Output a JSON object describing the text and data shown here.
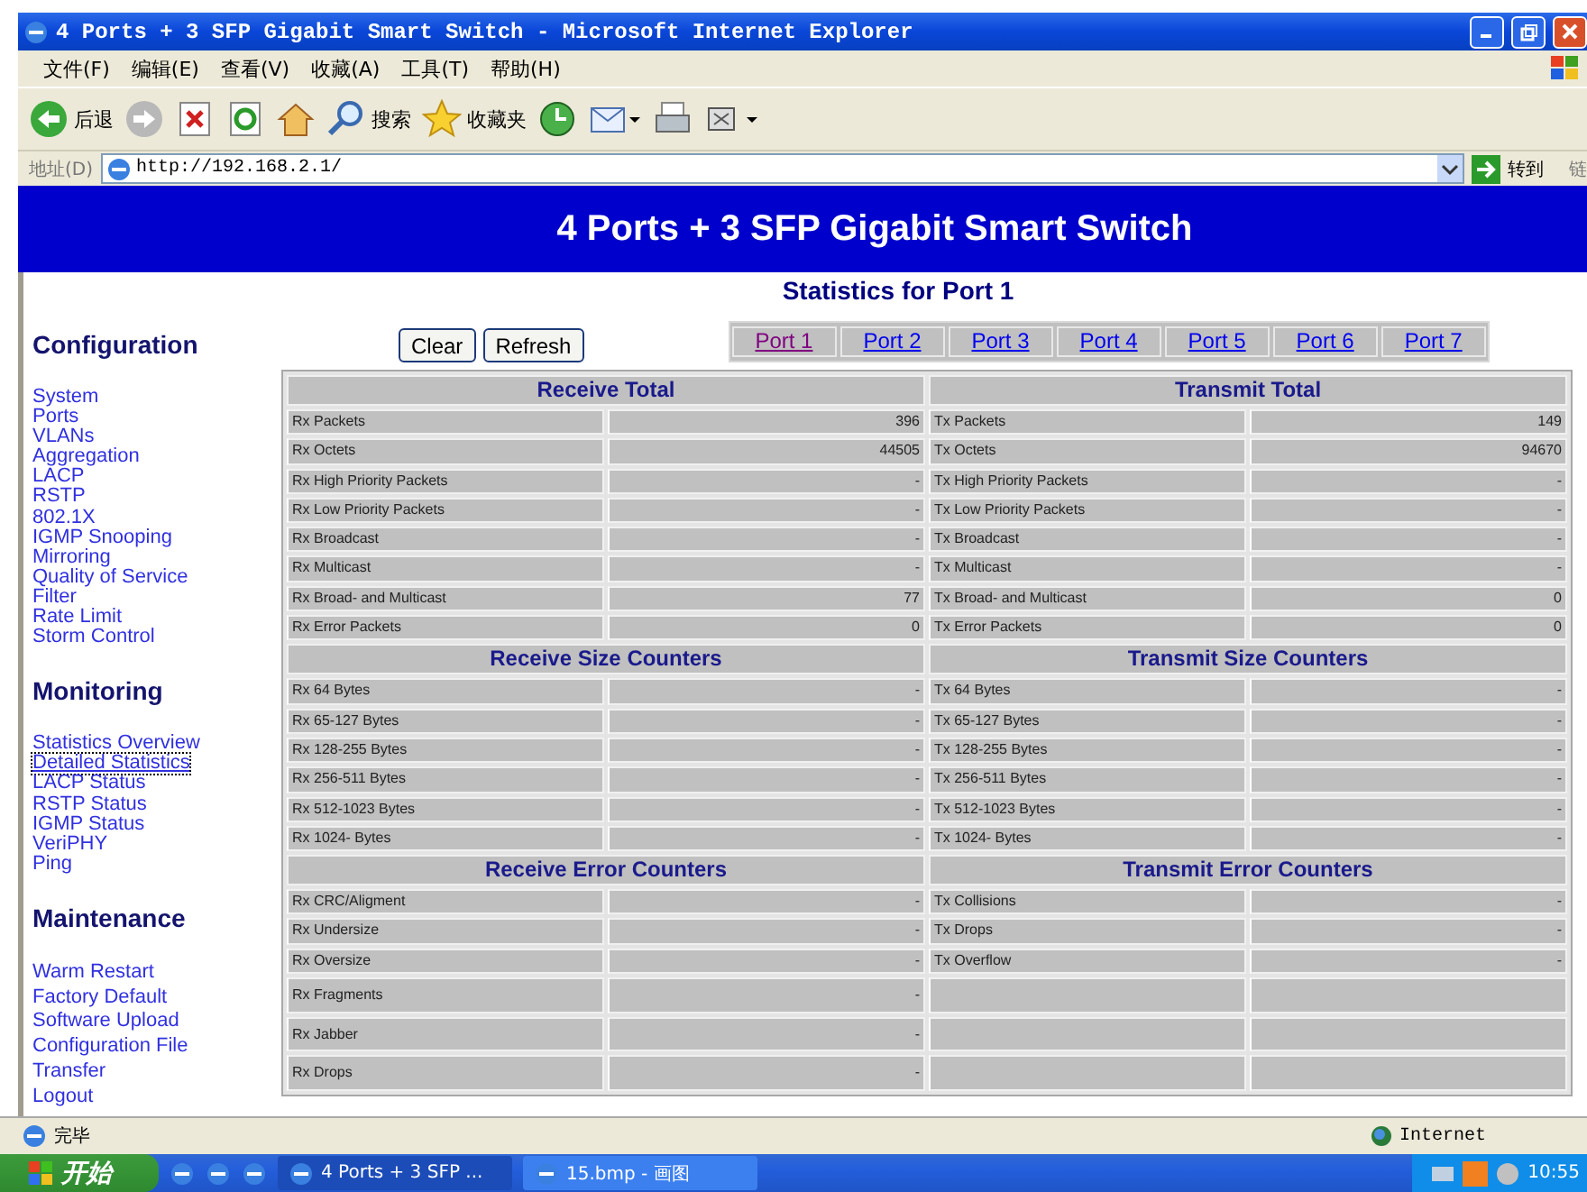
{
  "window": {
    "title": "4 Ports + 3 SFP Gigabit Smart Switch - Microsoft Internet Explorer"
  },
  "menu": [
    "文件(F)",
    "编辑(E)",
    "查看(V)",
    "收藏(A)",
    "工具(T)",
    "帮助(H)"
  ],
  "toolbar": [
    {
      "kind": "back",
      "label": "后退"
    },
    {
      "kind": "forward"
    },
    {
      "kind": "stop"
    },
    {
      "kind": "refresh"
    },
    {
      "kind": "home"
    },
    {
      "kind": "search",
      "label": "搜索"
    },
    {
      "kind": "favorites",
      "label": "收藏夹"
    },
    {
      "kind": "history"
    },
    {
      "kind": "mail"
    },
    {
      "kind": "print"
    },
    {
      "kind": "edit"
    }
  ],
  "address": {
    "label": "地址(D)",
    "value": "http://192.168.2.1/",
    "go": "转到",
    "links": "链"
  },
  "banner": "4 Ports + 3 SFP Gigabit Smart Switch",
  "page_title": "Statistics for Port 1",
  "sidebar": [
    {
      "title": "Configuration",
      "items": [
        {
          "label": "System",
          "selected": false
        },
        {
          "label": "Ports",
          "selected": false
        },
        {
          "label": "VLANs",
          "selected": false
        },
        {
          "label": "Aggregation",
          "selected": false
        },
        {
          "label": "LACP",
          "selected": false
        },
        {
          "label": "RSTP",
          "selected": false
        },
        {
          "label": "802.1X",
          "selected": false
        },
        {
          "label": "IGMP Snooping",
          "selected": false
        },
        {
          "label": "Mirroring",
          "selected": false
        },
        {
          "label": "Quality of Service",
          "selected": false
        },
        {
          "label": "Filter",
          "selected": false
        },
        {
          "label": "Rate Limit",
          "selected": false
        },
        {
          "label": "Storm Control",
          "selected": false
        }
      ]
    },
    {
      "title": "Monitoring",
      "items": [
        {
          "label": "Statistics Overview",
          "selected": false
        },
        {
          "label": "Detailed Statistics",
          "selected": true
        },
        {
          "label": "LACP Status",
          "selected": false
        },
        {
          "label": "RSTP Status",
          "selected": false
        },
        {
          "label": "IGMP Status",
          "selected": false
        },
        {
          "label": "VeriPHY",
          "selected": false
        },
        {
          "label": "Ping",
          "selected": false
        }
      ]
    },
    {
      "title": "Maintenance",
      "items": [
        {
          "label": "Warm Restart",
          "selected": false
        },
        {
          "label": "Factory Default",
          "selected": false
        },
        {
          "label": "Software Upload",
          "selected": false
        },
        {
          "label": "Configuration File",
          "selected": false
        },
        {
          "label": "Transfer",
          "selected": false
        },
        {
          "label": "Logout",
          "selected": false
        }
      ]
    }
  ],
  "buttons": [
    "Clear",
    "Refresh"
  ],
  "port_tabs": [
    {
      "label": "Port 1",
      "selected": true
    },
    {
      "label": "Port 2",
      "selected": false
    },
    {
      "label": "Port 3",
      "selected": false
    },
    {
      "label": "Port 4",
      "selected": false
    },
    {
      "label": "Port 5",
      "selected": false
    },
    {
      "label": "Port 6",
      "selected": false
    },
    {
      "label": "Port 7",
      "selected": false
    }
  ],
  "stats": [
    {
      "rx_title": "Receive Total",
      "tx_title": "Transmit Total",
      "rows": [
        {
          "rx_label": "Rx Packets",
          "rx_value": "396",
          "tx_label": "Tx Packets",
          "tx_value": "149"
        },
        {
          "rx_label": "Rx Octets",
          "rx_value": "44505",
          "tx_label": "Tx Octets",
          "tx_value": "94670"
        },
        {
          "rx_label": "Rx High Priority Packets",
          "rx_value": "-",
          "tx_label": "Tx High Priority Packets",
          "tx_value": "-"
        },
        {
          "rx_label": "Rx Low Priority Packets",
          "rx_value": "-",
          "tx_label": "Tx Low Priority Packets",
          "tx_value": "-"
        },
        {
          "rx_label": "Rx Broadcast",
          "rx_value": "-",
          "tx_label": "Tx Broadcast",
          "tx_value": "-"
        },
        {
          "rx_label": "Rx Multicast",
          "rx_value": "-",
          "tx_label": "Tx Multicast",
          "tx_value": "-"
        },
        {
          "rx_label": "Rx Broad- and Multicast",
          "rx_value": "77",
          "tx_label": "Tx Broad- and Multicast",
          "tx_value": "0"
        },
        {
          "rx_label": "Rx Error Packets",
          "rx_value": "0",
          "tx_label": "Tx Error Packets",
          "tx_value": "0"
        }
      ]
    },
    {
      "rx_title": "Receive Size Counters",
      "tx_title": "Transmit Size Counters",
      "rows": [
        {
          "rx_label": "Rx 64 Bytes",
          "rx_value": "-",
          "tx_label": "Tx 64 Bytes",
          "tx_value": "-"
        },
        {
          "rx_label": "Rx 65-127 Bytes",
          "rx_value": "-",
          "tx_label": "Tx 65-127 Bytes",
          "tx_value": "-"
        },
        {
          "rx_label": "Rx 128-255 Bytes",
          "rx_value": "-",
          "tx_label": "Tx 128-255 Bytes",
          "tx_value": "-"
        },
        {
          "rx_label": "Rx 256-511 Bytes",
          "rx_value": "-",
          "tx_label": "Tx 256-511 Bytes",
          "tx_value": "-"
        },
        {
          "rx_label": "Rx 512-1023 Bytes",
          "rx_value": "-",
          "tx_label": "Tx 512-1023 Bytes",
          "tx_value": "-"
        },
        {
          "rx_label": "Rx 1024- Bytes",
          "rx_value": "-",
          "tx_label": "Tx 1024- Bytes",
          "tx_value": "-"
        }
      ]
    },
    {
      "rx_title": "Receive Error Counters",
      "tx_title": "Transmit Error Counters",
      "rows": [
        {
          "rx_label": "Rx CRC/Aligment",
          "rx_value": "-",
          "tx_label": "Tx Collisions",
          "tx_value": "-"
        },
        {
          "rx_label": "Rx Undersize",
          "rx_value": "-",
          "tx_label": "Tx Drops",
          "tx_value": "-"
        },
        {
          "rx_label": "Rx Oversize",
          "rx_value": "-",
          "tx_label": "Tx Overflow",
          "tx_value": "-"
        },
        {
          "rx_label": "Rx Fragments",
          "rx_value": "-"
        },
        {
          "rx_label": "Rx Jabber",
          "rx_value": "-"
        },
        {
          "rx_label": "Rx Drops",
          "rx_value": "-"
        }
      ]
    }
  ],
  "status_bar": {
    "text": "完毕",
    "zone": "Internet"
  },
  "taskbar": {
    "start": "开始",
    "tasks": [
      {
        "label": "4 Ports + 3 SFP ...",
        "selected": true
      },
      {
        "label": "15.bmp - 画图",
        "selected": false
      }
    ],
    "clock": "10:55"
  }
}
